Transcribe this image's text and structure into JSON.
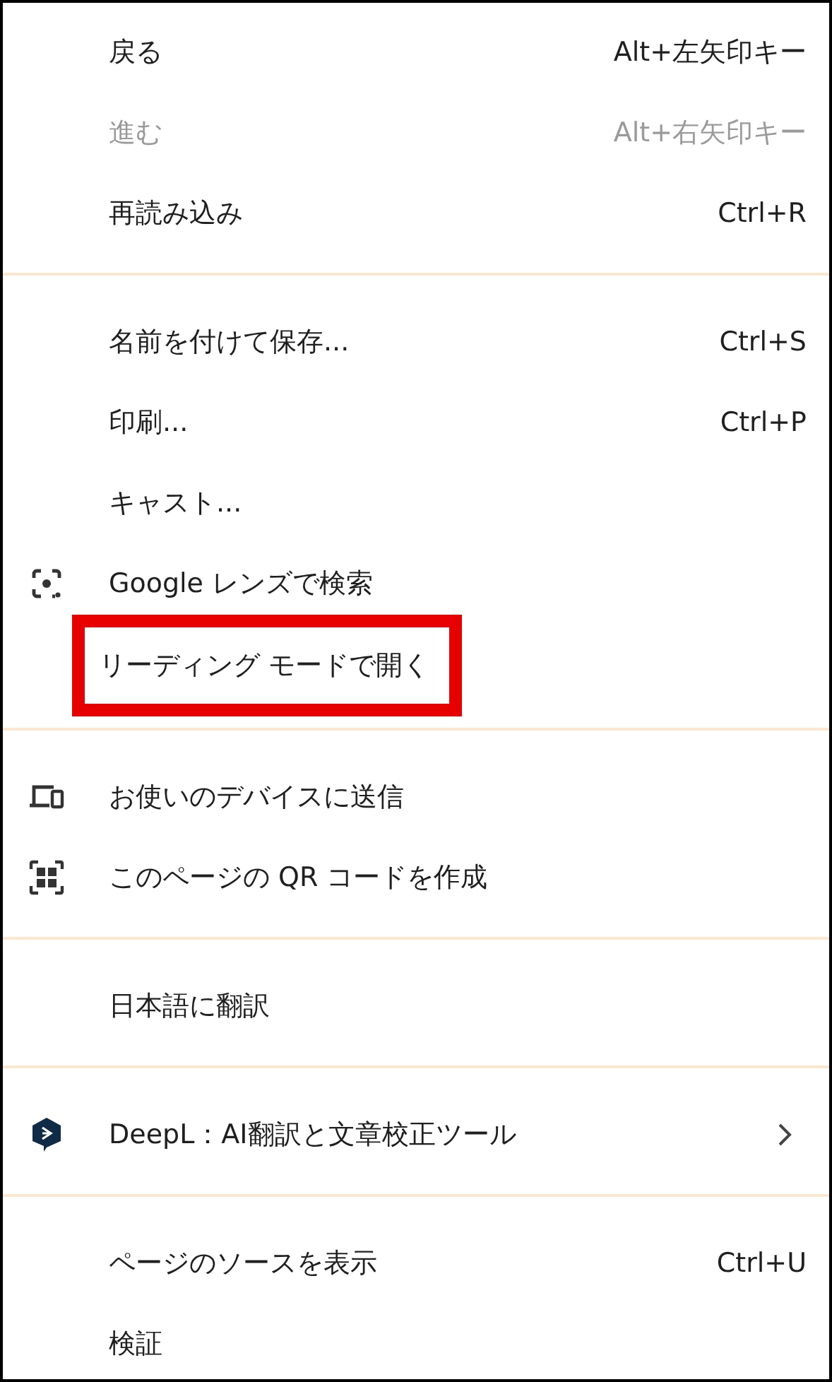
{
  "sections": [
    {
      "items": [
        {
          "label": "戻る",
          "shortcut": "Alt+左矢印キー",
          "disabled": false
        },
        {
          "label": "進む",
          "shortcut": "Alt+右矢印キー",
          "disabled": true
        },
        {
          "label": "再読み込み",
          "shortcut": "Ctrl+R",
          "disabled": false
        }
      ]
    },
    {
      "items": [
        {
          "label": "名前を付けて保存...",
          "shortcut": "Ctrl+S",
          "disabled": false
        },
        {
          "label": "印刷...",
          "shortcut": "Ctrl+P",
          "disabled": false
        },
        {
          "label": "キャスト...",
          "disabled": false
        },
        {
          "label": "Google レンズで検索",
          "kind": "lens",
          "disabled": false
        },
        {
          "label": "リーディング モードで開く",
          "disabled": false,
          "highlighted": true
        }
      ]
    },
    {
      "items": [
        {
          "label": "お使いのデバイスに送信",
          "kind": "devices",
          "disabled": false
        },
        {
          "label": "このページの QR コードを作成",
          "kind": "qr",
          "disabled": false
        }
      ]
    },
    {
      "items": [
        {
          "label": "日本語に翻訳",
          "disabled": false
        }
      ]
    },
    {
      "items": [
        {
          "label": "DeepL：AI翻訳と文章校正ツール",
          "kind": "deepl",
          "submenu": true,
          "disabled": false
        }
      ]
    },
    {
      "items": [
        {
          "label": "ページのソースを表示",
          "shortcut": "Ctrl+U",
          "disabled": false
        },
        {
          "label": "検証",
          "disabled": false
        }
      ]
    }
  ]
}
